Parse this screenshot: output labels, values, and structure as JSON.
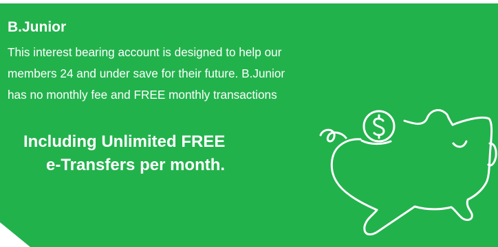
{
  "account": {
    "title": "B.Junior",
    "description_lines": [
      "This interest bearing account is designed to help our",
      "members 24 and under save for their future. B.Junior",
      "has no monthly fee and FREE monthly transactions"
    ],
    "highlight_lines": [
      "Including Unlimited FREE",
      "e-Transfers per month."
    ]
  },
  "icons": {
    "illustration": "piggy-bank-with-coin-icon"
  },
  "colors": {
    "background": "#22b24c",
    "text": "#ffffff"
  }
}
